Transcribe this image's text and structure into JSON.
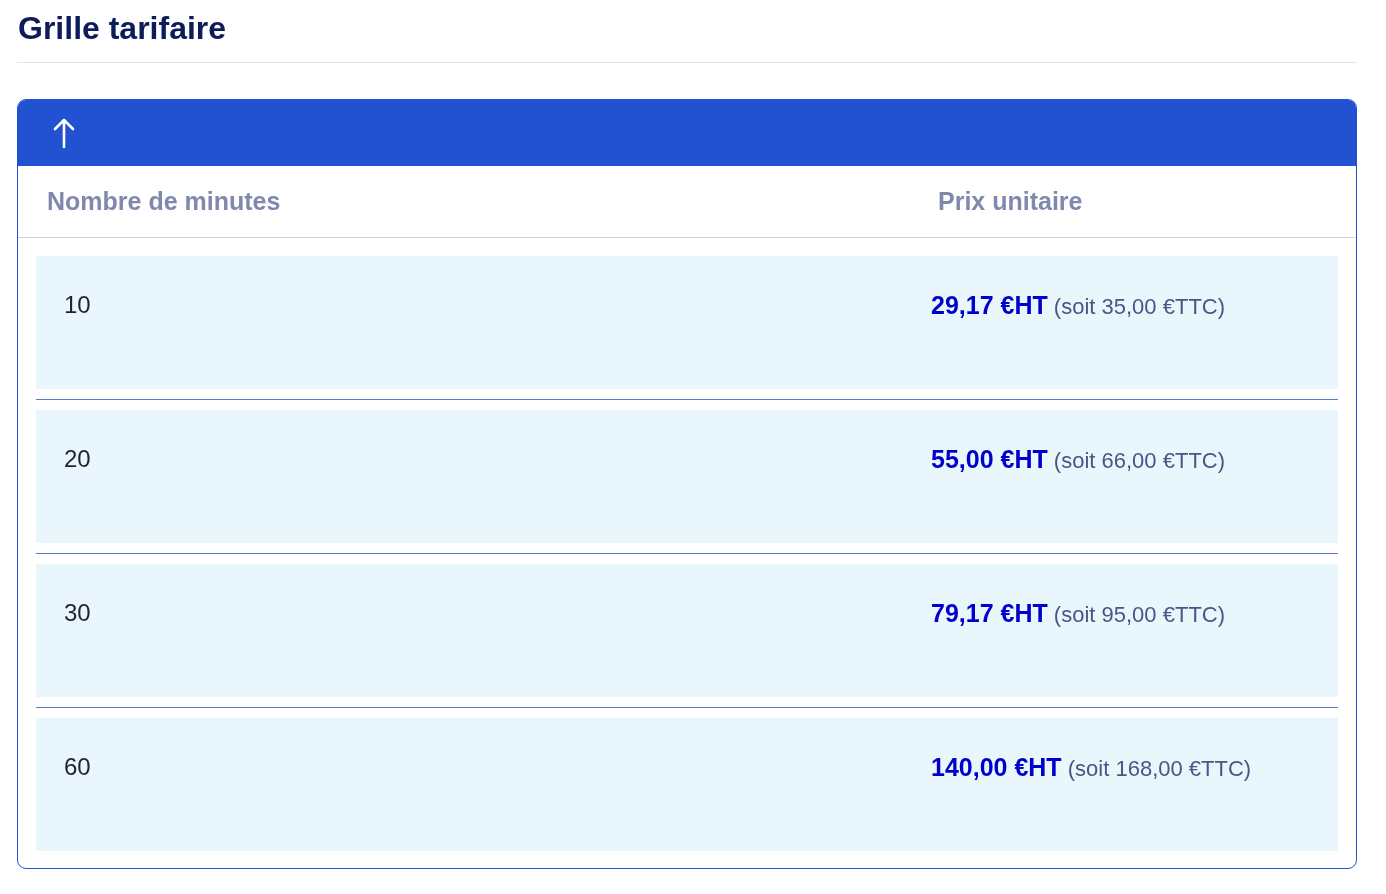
{
  "title": "Grille tarifaire",
  "table": {
    "columns": [
      "Nombre de minutes",
      "Prix unitaire"
    ],
    "rows": [
      {
        "minutes": "10",
        "price": "**29,17 €HT** (soit 35,00 €TTC)"
      },
      {
        "minutes": "20",
        "price": "**55,00 €HT** (soit 66,00 €TTC)"
      },
      {
        "minutes": "30",
        "price": "**79,17 €HT** (soit 95,00 €TTC)"
      },
      {
        "minutes": "60",
        "price": "**140,00 €HT** (soit 168,00 €TTC)"
      }
    ]
  }
}
